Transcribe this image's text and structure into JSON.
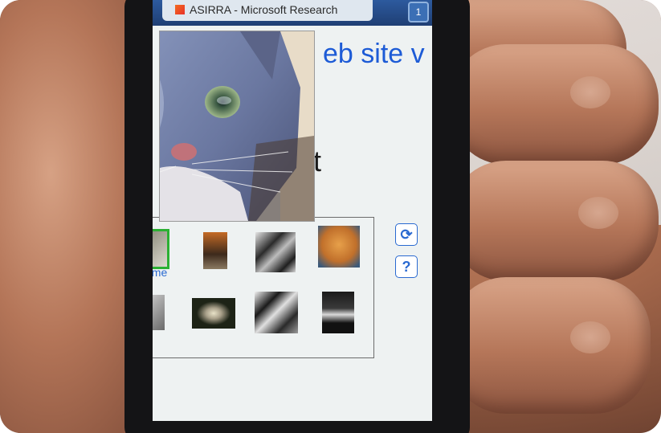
{
  "browser": {
    "tab_title": "ASIRRA - Microsoft Research",
    "tab_count": "1"
  },
  "page": {
    "heading_fragment": "eb site v",
    "letter_fragment": "t",
    "adopt_fragment": "t me"
  },
  "captcha": {
    "refresh_icon": "refresh-icon",
    "help_icon": "help-icon",
    "help_glyph": "?",
    "refresh_glyph": "⟳"
  },
  "colors": {
    "accent": "#1d5bd6",
    "tab_bar": "#1f3f74",
    "favicon": "#e8312a"
  }
}
